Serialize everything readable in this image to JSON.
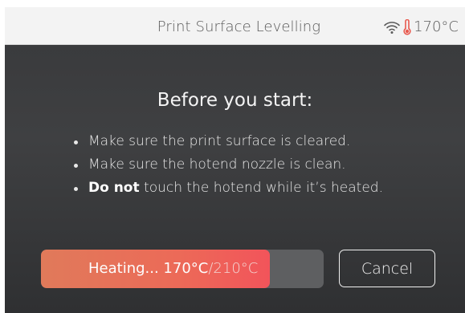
{
  "header": {
    "title": "Print Surface Levelling",
    "temperature": "170°C",
    "wifi_icon": "wifi-icon",
    "thermometer_icon": "thermometer-icon",
    "thermometer_color": "#e85a4f"
  },
  "main": {
    "heading": "Before you start:",
    "bullets": [
      "Make sure the print surface is cleared.",
      "Make sure the hotend nozzle is clean."
    ],
    "warning_bold": "Do not",
    "warning_rest": " touch the hotend while it’s heated."
  },
  "progress": {
    "label": "Heating... ",
    "current": "170°C",
    "target": "/210°C",
    "value_fraction": 0.81,
    "fill_color": "#ec6a58"
  },
  "actions": {
    "cancel_label": "Cancel"
  }
}
